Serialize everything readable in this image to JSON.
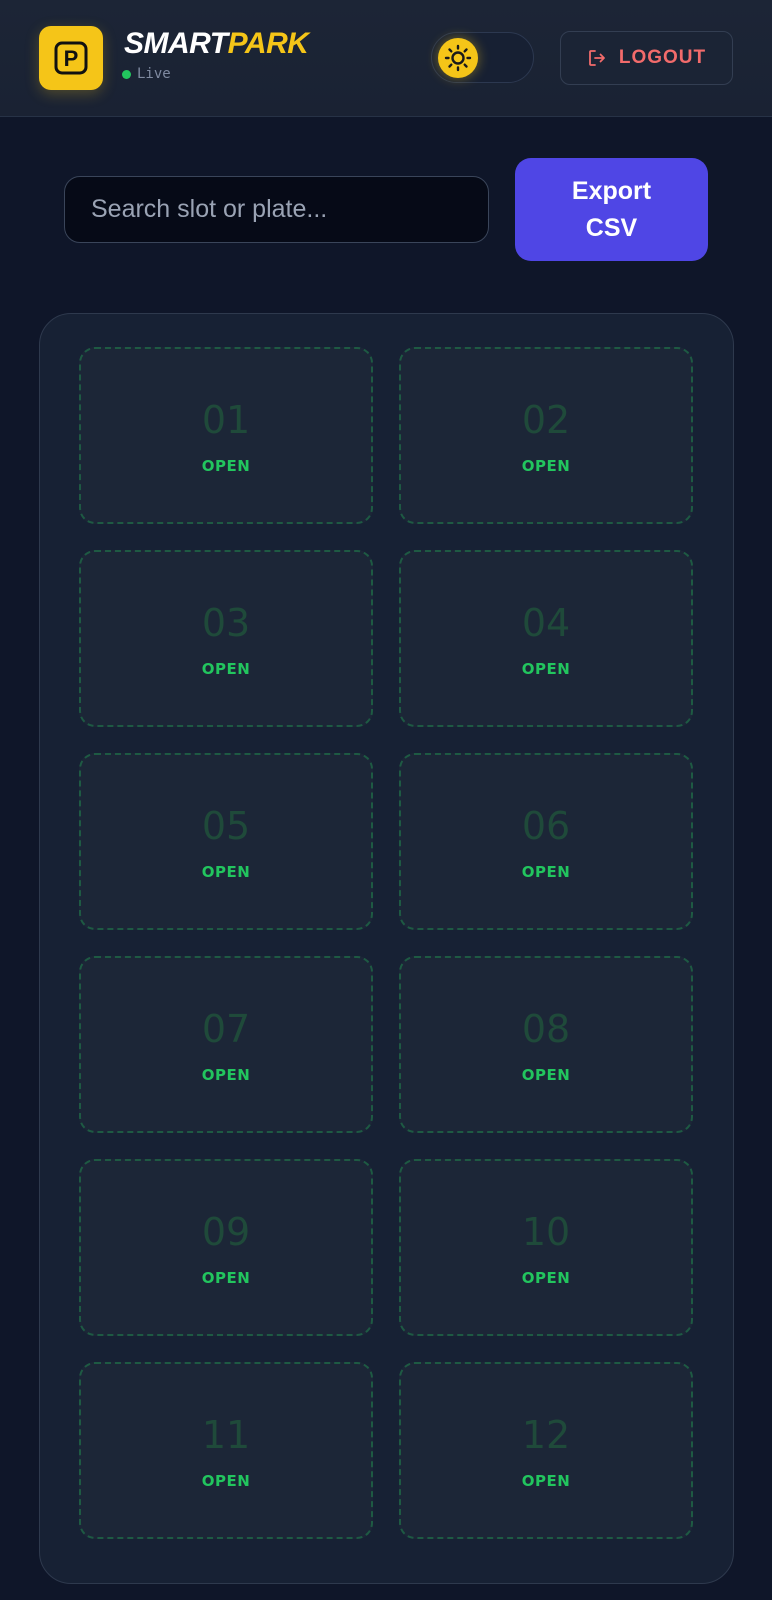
{
  "header": {
    "logo_letter": "P",
    "brand_part1": "SMART",
    "brand_part2": "PARK",
    "status": "Live",
    "logout_label": "LOGOUT"
  },
  "toolbar": {
    "search_placeholder": "Search slot or plate...",
    "export_label": "Export CSV"
  },
  "slots": [
    {
      "number": "01",
      "status": "OPEN"
    },
    {
      "number": "02",
      "status": "OPEN"
    },
    {
      "number": "03",
      "status": "OPEN"
    },
    {
      "number": "04",
      "status": "OPEN"
    },
    {
      "number": "05",
      "status": "OPEN"
    },
    {
      "number": "06",
      "status": "OPEN"
    },
    {
      "number": "07",
      "status": "OPEN"
    },
    {
      "number": "08",
      "status": "OPEN"
    },
    {
      "number": "09",
      "status": "OPEN"
    },
    {
      "number": "10",
      "status": "OPEN"
    },
    {
      "number": "11",
      "status": "OPEN"
    },
    {
      "number": "12",
      "status": "OPEN"
    }
  ],
  "colors": {
    "accent_yellow": "#f5c518",
    "accent_indigo": "#4f46e5",
    "open_green": "#22c55e",
    "logout_red": "#f26b6b",
    "background": "#0f1629"
  }
}
